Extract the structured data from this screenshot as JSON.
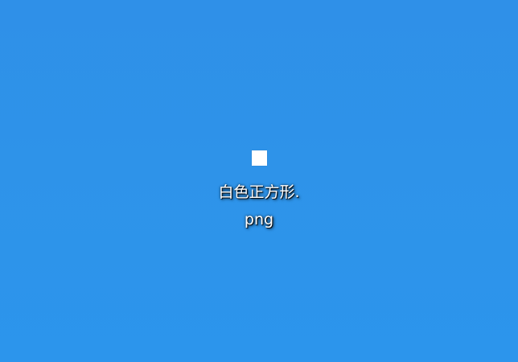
{
  "desktop": {
    "background_color": "#2e93e9",
    "file": {
      "icon": "white-square-image-thumbnail",
      "name_line1": "白色正方形.",
      "name_line2": "png"
    }
  }
}
